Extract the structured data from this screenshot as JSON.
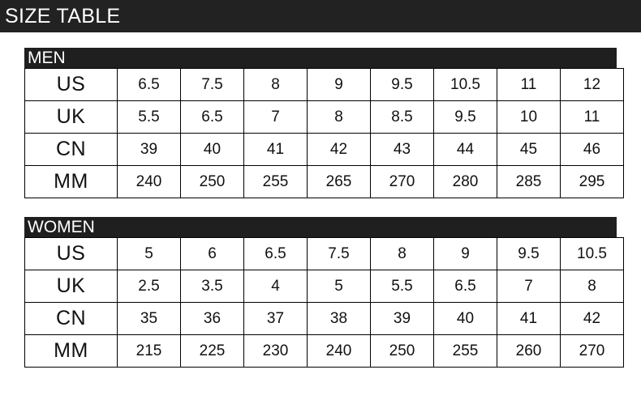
{
  "banner": {
    "title": "SIZE TABLE",
    "background_color": "#222222",
    "text_color": "#ffffff"
  },
  "tables": [
    {
      "category": "MEN",
      "rows": [
        {
          "label": "US",
          "values": [
            "6.5",
            "7.5",
            "8",
            "9",
            "9.5",
            "10.5",
            "11",
            "12"
          ]
        },
        {
          "label": "UK",
          "values": [
            "5.5",
            "6.5",
            "7",
            "8",
            "8.5",
            "9.5",
            "10",
            "11"
          ]
        },
        {
          "label": "CN",
          "values": [
            "39",
            "40",
            "41",
            "42",
            "43",
            "44",
            "45",
            "46"
          ]
        },
        {
          "label": "MM",
          "values": [
            "240",
            "250",
            "255",
            "265",
            "270",
            "280",
            "285",
            "295"
          ]
        }
      ]
    },
    {
      "category": "WOMEN",
      "rows": [
        {
          "label": "US",
          "values": [
            "5",
            "6",
            "6.5",
            "7.5",
            "8",
            "9",
            "9.5",
            "10.5"
          ]
        },
        {
          "label": "UK",
          "values": [
            "2.5",
            "3.5",
            "4",
            "5",
            "5.5",
            "6.5",
            "7",
            "8"
          ]
        },
        {
          "label": "CN",
          "values": [
            "35",
            "36",
            "37",
            "38",
            "39",
            "40",
            "41",
            "42"
          ]
        },
        {
          "label": "MM",
          "values": [
            "215",
            "225",
            "230",
            "240",
            "250",
            "255",
            "260",
            "270"
          ]
        }
      ]
    }
  ],
  "colors": {
    "header_bar": "#1f1f1f",
    "banner": "#222222",
    "border": "#000000",
    "cell_background": "#ffffff",
    "cell_text": "#111111"
  }
}
